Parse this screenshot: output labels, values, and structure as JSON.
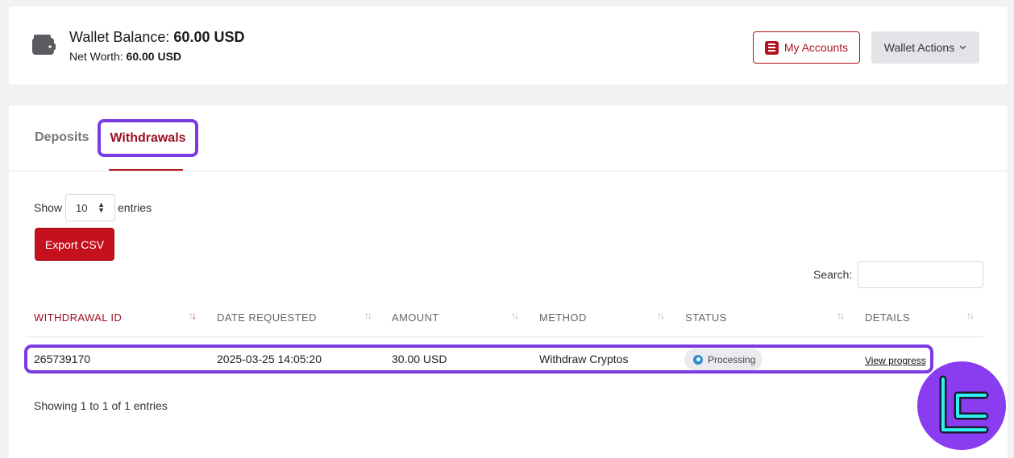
{
  "header": {
    "wallet_balance_label": "Wallet Balance:",
    "wallet_balance_value": "60.00 USD",
    "net_worth_label": "Net Worth:",
    "net_worth_value": "60.00 USD",
    "my_accounts_label": "My Accounts",
    "wallet_actions_label": "Wallet Actions"
  },
  "tabs": [
    {
      "label": "Deposits",
      "active": false
    },
    {
      "label": "Withdrawals",
      "active": true
    }
  ],
  "controls": {
    "show_label": "Show",
    "entries_value": "10",
    "entries_label": "entries",
    "export_label": "Export CSV",
    "search_label": "Search:",
    "search_value": ""
  },
  "table": {
    "columns": [
      "WITHDRAWAL ID",
      "DATE REQUESTED",
      "AMOUNT",
      "METHOD",
      "STATUS",
      "DETAILS"
    ],
    "rows": [
      {
        "id": "265739170",
        "date": "2025-03-25 14:05:20",
        "amount": "30.00 USD",
        "method": "Withdraw Cryptos",
        "status": "Processing",
        "details": "View progress"
      }
    ],
    "footer": "Showing 1 to 1 of 1 entries"
  },
  "colors": {
    "brand": "#b0141e",
    "highlight": "#7b3ae3",
    "status_processing": "#2c8bd1"
  },
  "icons": [
    "wallet-icon",
    "accounts-list-icon",
    "chevron-down-icon",
    "sort-icon",
    "processing-status-icon",
    "brand-logo"
  ]
}
